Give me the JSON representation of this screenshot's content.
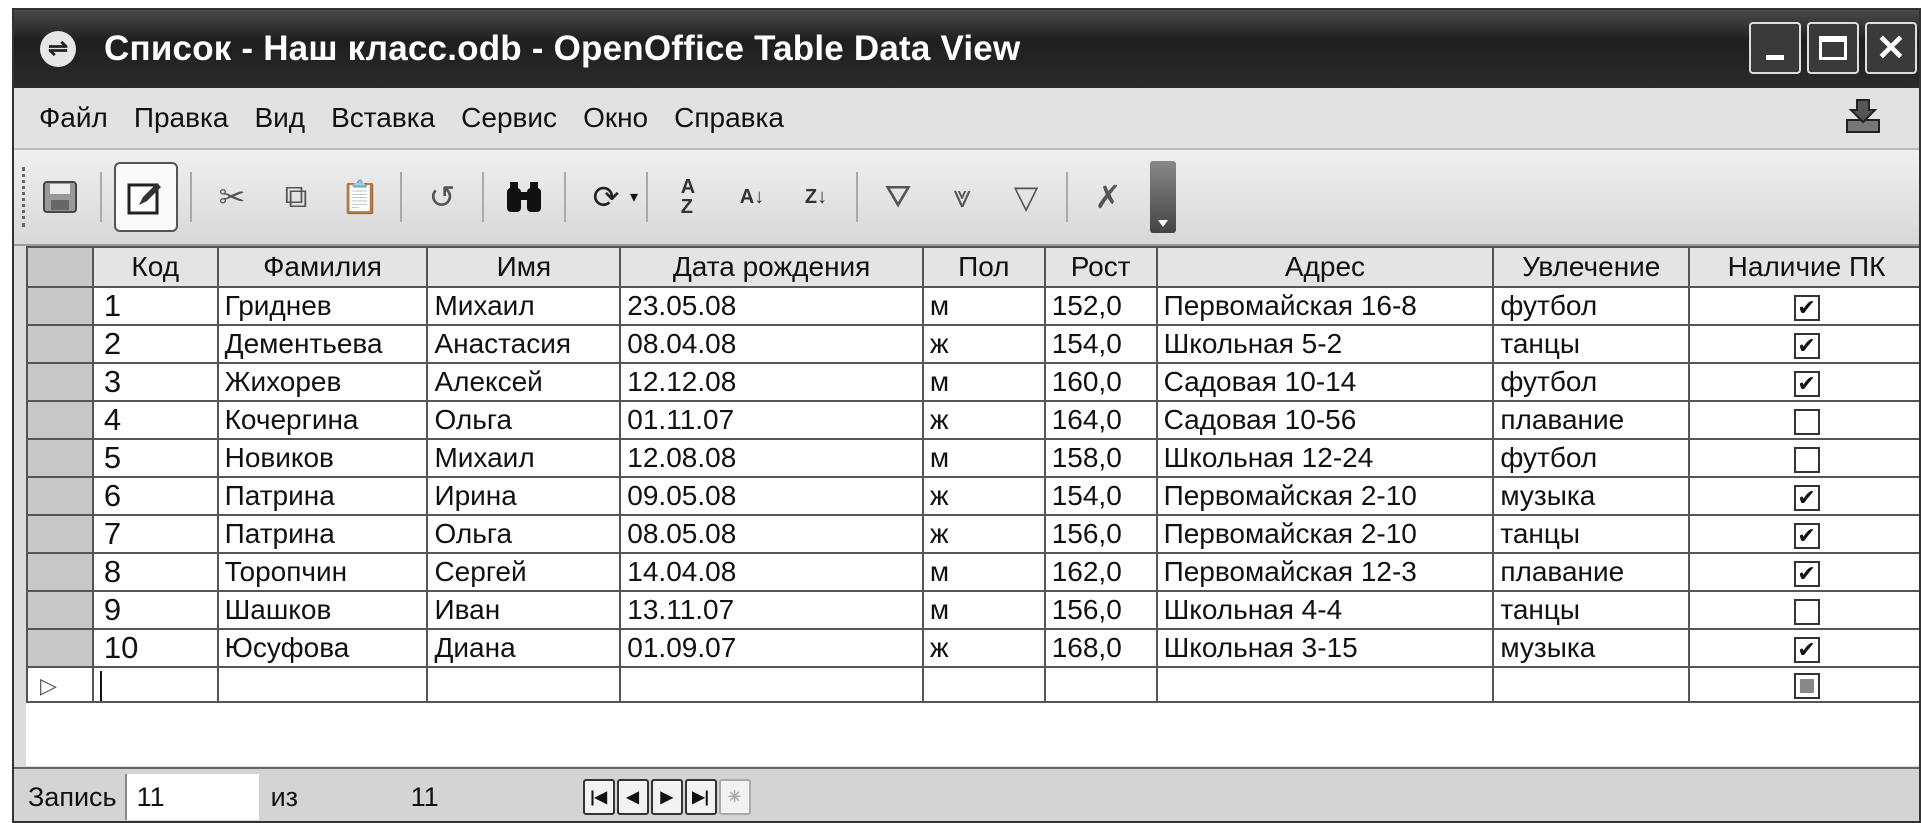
{
  "window": {
    "title": "Список - Наш класс.odb - OpenOffice Table Data View"
  },
  "menu": {
    "items": [
      "Файл",
      "Правка",
      "Вид",
      "Вставка",
      "Сервис",
      "Окно",
      "Справка"
    ]
  },
  "table": {
    "columns": [
      "Код",
      "Фамилия",
      "Имя",
      "Дата рождения",
      "Пол",
      "Рост",
      "Адрес",
      "Увлечение",
      "Наличие ПК"
    ],
    "rows": [
      {
        "code": "1",
        "surname": "Гриднев",
        "name": "Михаил",
        "birth": "23.05.08",
        "sex": "м",
        "height": "152,0",
        "address": "Первомайская 16-8",
        "hobby": "футбол",
        "pc": true
      },
      {
        "code": "2",
        "surname": "Дементьева",
        "name": "Анастасия",
        "birth": "08.04.08",
        "sex": "ж",
        "height": "154,0",
        "address": "Школьная 5-2",
        "hobby": "танцы",
        "pc": true
      },
      {
        "code": "3",
        "surname": "Жихорев",
        "name": "Алексей",
        "birth": "12.12.08",
        "sex": "м",
        "height": "160,0",
        "address": "Садовая 10-14",
        "hobby": "футбол",
        "pc": true
      },
      {
        "code": "4",
        "surname": "Кочергина",
        "name": "Ольга",
        "birth": "01.11.07",
        "sex": "ж",
        "height": "164,0",
        "address": "Садовая 10-56",
        "hobby": "плавание",
        "pc": false
      },
      {
        "code": "5",
        "surname": "Новиков",
        "name": "Михаил",
        "birth": "12.08.08",
        "sex": "м",
        "height": "158,0",
        "address": "Школьная 12-24",
        "hobby": "футбол",
        "pc": false
      },
      {
        "code": "6",
        "surname": "Патрина",
        "name": "Ирина",
        "birth": "09.05.08",
        "sex": "ж",
        "height": "154,0",
        "address": "Первомайская 2-10",
        "hobby": "музыка",
        "pc": true
      },
      {
        "code": "7",
        "surname": "Патрина",
        "name": "Ольга",
        "birth": "08.05.08",
        "sex": "ж",
        "height": "156,0",
        "address": "Первомайская 2-10",
        "hobby": "танцы",
        "pc": true
      },
      {
        "code": "8",
        "surname": "Торопчин",
        "name": "Сергей",
        "birth": "14.04.08",
        "sex": "м",
        "height": "162,0",
        "address": "Первомайская 12-3",
        "hobby": "плавание",
        "pc": true
      },
      {
        "code": "9",
        "surname": "Шашков",
        "name": "Иван",
        "birth": "13.11.07",
        "sex": "м",
        "height": "156,0",
        "address": "Школьная 4-4",
        "hobby": "танцы",
        "pc": false
      },
      {
        "code": "10",
        "surname": "Юсуфова",
        "name": "Диана",
        "birth": "01.09.07",
        "sex": "ж",
        "height": "168,0",
        "address": "Школьная 3-15",
        "hobby": "музыка",
        "pc": true
      }
    ]
  },
  "navigator": {
    "record_label": "Запись",
    "record_value": "11",
    "of_label": "из",
    "total": "11"
  },
  "icons": {
    "app": "openoffice-icon",
    "checked_mark": "✔"
  }
}
